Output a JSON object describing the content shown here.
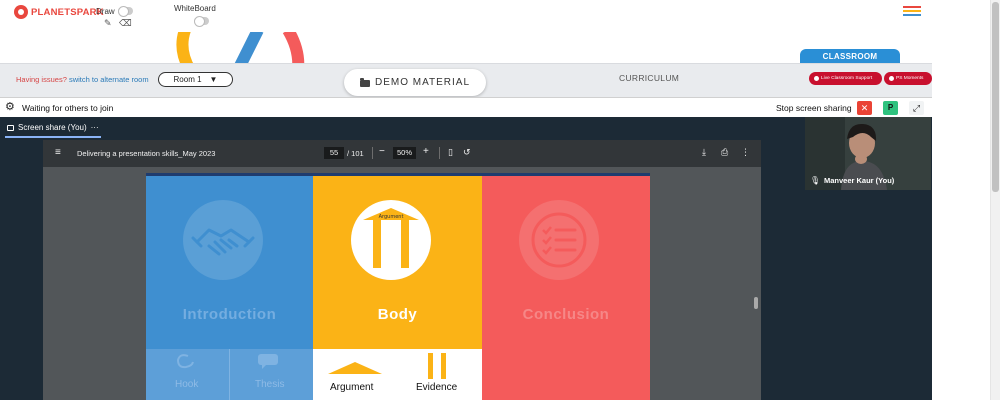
{
  "app": {
    "logo_text": "PLANETSPARK"
  },
  "topbar": {
    "draw_label": "Draw",
    "whiteboard_label": "WhiteBoard"
  },
  "toolbar": {
    "issues_text": "Having issues?",
    "issues_link": "switch to alternate room",
    "room_value": "Room 1",
    "room_caret": "▼",
    "demo_material": "DEMO MATERIAL",
    "curriculum": "CURRICULUM",
    "classroom_tab": "CLASSROOM",
    "live_support": "Live Classroom Support",
    "ps_moments": "PS Moments"
  },
  "meeting": {
    "waiting_text": "Waiting for others to join",
    "stop_sharing": "Stop screen sharing",
    "close_glyph": "✕",
    "p_glyph": "P",
    "expand_glyph": "⤢",
    "share_tab_label": "Screen share (You)",
    "share_tab_more": "···",
    "participant_name": "Manveer Kaur (You)"
  },
  "pdf": {
    "title": "Delivering a presentation skills_May 2023",
    "page": "55",
    "total": "/ 101",
    "zoom": "50%"
  },
  "slide": {
    "columns": [
      {
        "title": "Introduction",
        "sub": [
          "Hook",
          "Thesis"
        ]
      },
      {
        "title": "Body",
        "sub": [
          "Argument",
          "Evidence"
        ]
      },
      {
        "title": "Conclusion"
      }
    ],
    "arrow_label": "Argument",
    "evidence_letters": "EVIDENCE"
  },
  "colors": {
    "intro": "#3f8fd0",
    "body": "#fbb316",
    "conclusion": "#f45b5b",
    "brand_red": "#c8102e",
    "classroom_blue": "#2a8fd6"
  },
  "icons": [
    "pencil-icon",
    "eraser-icon",
    "hamburger-icon",
    "folder-icon",
    "gear-icon",
    "close-icon",
    "expand-icon",
    "handshake-icon",
    "checklist-icon",
    "microphone-icon"
  ]
}
